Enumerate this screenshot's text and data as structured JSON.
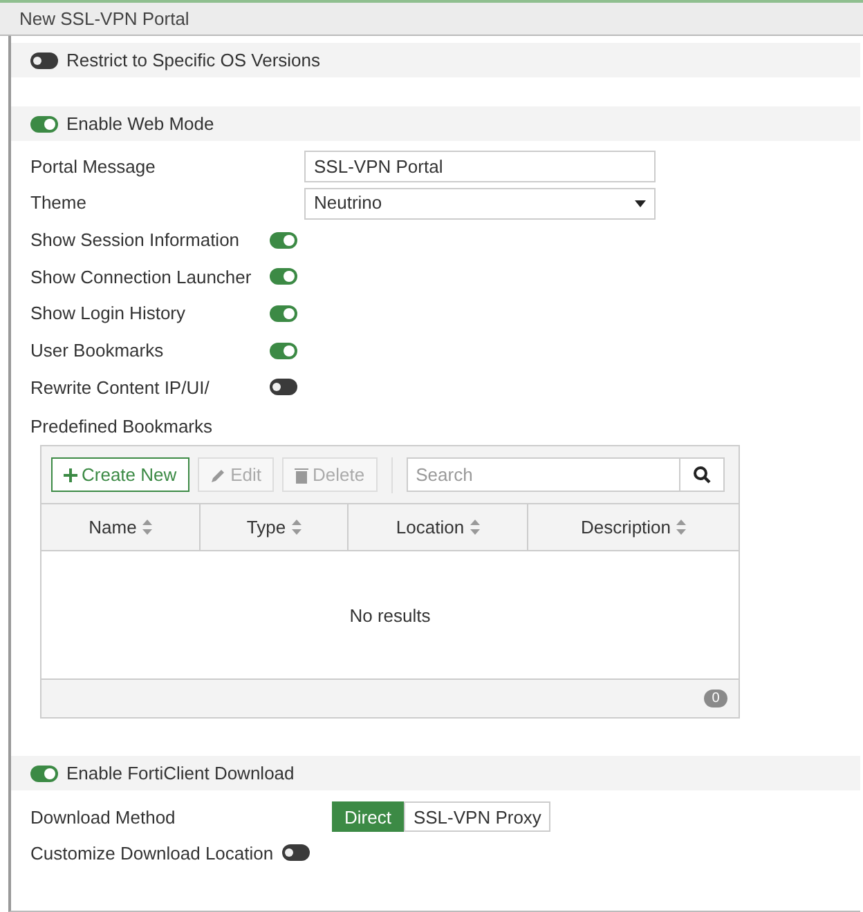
{
  "window": {
    "title": "New SSL-VPN Portal"
  },
  "restrict_os": {
    "label": "Restrict to Specific OS Versions",
    "on": false
  },
  "web_mode": {
    "label": "Enable Web Mode",
    "on": true,
    "fields": [
      {
        "kind": "text",
        "label": "Portal Message",
        "value": "SSL-VPN Portal"
      },
      {
        "kind": "select",
        "label": "Theme",
        "value": "Neutrino"
      },
      {
        "kind": "toggle",
        "label": "Show Session Information",
        "on": true
      },
      {
        "kind": "toggle",
        "label": "Show Connection Launcher",
        "on": true
      },
      {
        "kind": "toggle",
        "label": "Show Login History",
        "on": true
      },
      {
        "kind": "toggle",
        "label": "User Bookmarks",
        "on": true
      },
      {
        "kind": "toggle",
        "label": "Rewrite Content IP/UI/",
        "on": false
      }
    ]
  },
  "predefined_bookmarks": {
    "label": "Predefined Bookmarks",
    "buttons": [
      {
        "kind": "plus",
        "label": "Create New",
        "disabled": false
      },
      {
        "kind": "pencil",
        "label": "Edit",
        "disabled": true
      },
      {
        "kind": "trash",
        "label": "Delete",
        "disabled": true
      }
    ],
    "search": {
      "placeholder": "Search"
    },
    "columns": [
      "Name",
      "Type",
      "Location",
      "Description"
    ],
    "empty_text": "No results",
    "count": "0"
  },
  "forticlient_download": {
    "label": "Enable FortiClient Download",
    "on": true,
    "download_method": {
      "label": "Download Method",
      "options": [
        {
          "label": "Direct",
          "selected": true
        },
        {
          "label": "SSL-VPN Proxy",
          "selected": false
        }
      ]
    },
    "customize_location": {
      "label": "Customize Download Location",
      "on": false
    }
  }
}
